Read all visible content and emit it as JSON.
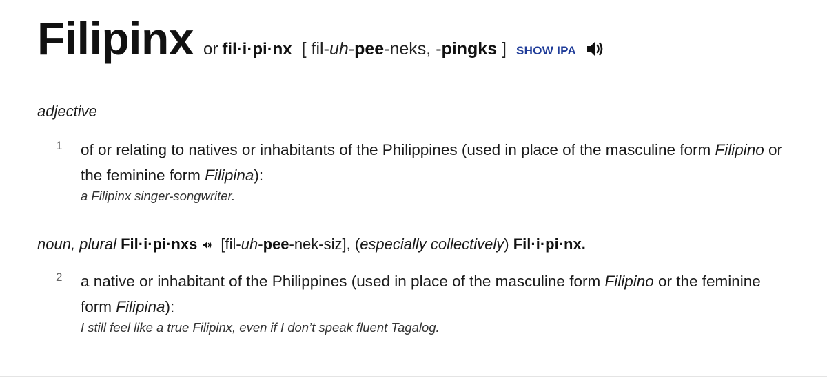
{
  "entry": {
    "headword": "Filipinx",
    "alt_or": "or",
    "alt_spelling": "fil·i·pi·nx",
    "pronunciation": {
      "open": "[ fil-",
      "p1_italic": "uh",
      "p2_sep": "-",
      "p3_bold": "pee",
      "p4": "-neks, -",
      "p5_bold": "pingks",
      "close": " ]"
    },
    "show_ipa_label": "SHOW IPA",
    "audio_icon": "speaker-icon"
  },
  "senses_adjective": {
    "part_of_speech": "adjective",
    "items": [
      {
        "number": "1",
        "def_a": "of or relating to natives or inhabitants of the Philippines (used in place of the masculine form ",
        "def_b_italic": "Filipino",
        "def_c": " or the feminine form ",
        "def_d_italic": "Filipina",
        "def_e": "):",
        "example": "a Filipinx singer-songwriter."
      }
    ]
  },
  "senses_noun": {
    "pos_italic": "noun, plural ",
    "plural_bold": "Fil·i·pi·nxs",
    "plural_pron_open": " [fil-",
    "plural_pron_italic": "uh",
    "plural_pron_sep": "-",
    "plural_pron_bold": "pee",
    "plural_pron_rest": "-nek-siz], (",
    "collective_italic": "especially collectively",
    "collective_close": ") ",
    "collective_bold": "Fil·i·pi·nx.",
    "items": [
      {
        "number": "2",
        "def_a": "a native or inhabitant of the Philippines (used in place of the masculine form ",
        "def_b_italic": "Filipino",
        "def_c": " or the feminine form ",
        "def_d_italic": "Filipina",
        "def_e": "):",
        "example": "I still feel like a true Filipinx, even if I don’t speak fluent Tagalog."
      }
    ]
  },
  "colors": {
    "link_blue": "#1f3c99",
    "divider": "#bdbdbd",
    "sense_number": "#666666"
  }
}
